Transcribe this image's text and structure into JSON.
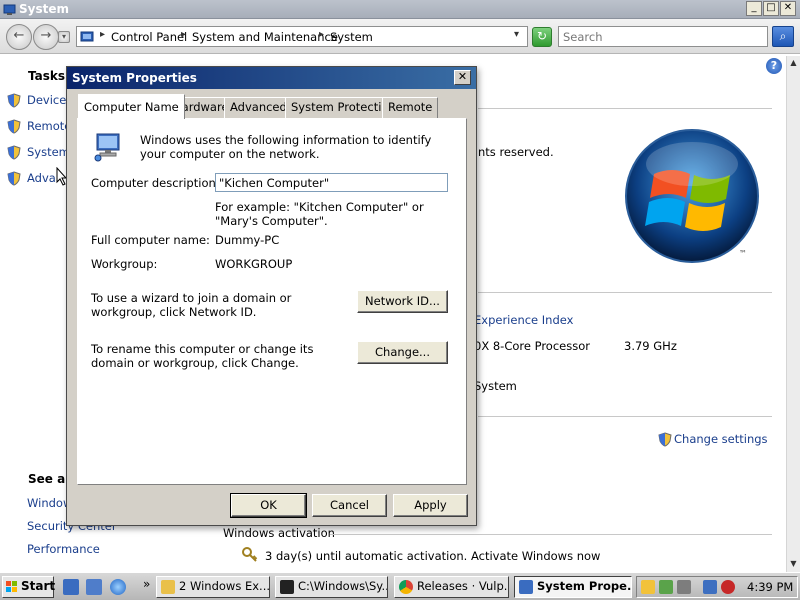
{
  "window": {
    "title": "System",
    "min": "_",
    "max": "□",
    "close": "✕"
  },
  "nav": {
    "back": "←",
    "forward": "→",
    "crumbs": [
      "Control Panel",
      "System and Maintenance",
      "System"
    ],
    "search_placeholder": "Search",
    "search_icon": "search-icon",
    "refresh_icon": "refresh-icon"
  },
  "background": {
    "tasks_heading": "Tasks",
    "tasks": [
      "Device M",
      "Remote",
      "System",
      "Advan"
    ],
    "see_also_heading": "See als",
    "see_also": [
      "Window",
      "Security Center",
      "Performance"
    ],
    "rights_text": "nts reserved.",
    "experience_index": "Experience Index",
    "processor": "0X 8-Core Processor",
    "processor_speed": "3.79 GHz",
    "system_type": "System",
    "change_settings": "Change settings",
    "activation_heading": "Windows activation",
    "activation_text": "3 day(s) until automatic activation. Activate Windows now",
    "help": "?"
  },
  "dialog": {
    "title": "System Properties",
    "close": "✕",
    "tabs": [
      "Computer Name",
      "Hardware",
      "Advanced",
      "System Protection",
      "Remote"
    ],
    "active_tab": "Computer Name",
    "intro": "Windows uses the following information to identify your computer on the network.",
    "description_label": "Computer description:",
    "description_value": "\"Kichen Computer\"",
    "example": "For example: \"Kitchen Computer\" or \"Mary's Computer\".",
    "full_name_label": "Full computer name:",
    "full_name_value": "Dummy-PC",
    "workgroup_label": "Workgroup:",
    "workgroup_value": "WORKGROUP",
    "wizard_text": "To use a wizard to join a domain or workgroup, click Network ID.",
    "network_id_button": "Network ID...",
    "rename_text": "To rename this computer or change its domain or workgroup, click Change.",
    "change_button": "Change...",
    "ok": "OK",
    "cancel": "Cancel",
    "apply": "Apply"
  },
  "taskbar": {
    "start": "Start",
    "overflow": "»",
    "buttons": [
      {
        "label": "2 Windows Ex...",
        "icon": "folder-icon"
      },
      {
        "label": "C:\\Windows\\Sy...",
        "icon": "console-icon"
      },
      {
        "label": "Releases · Vulp...",
        "icon": "chrome-icon"
      },
      {
        "label": "System Prope...",
        "icon": "system-icon"
      }
    ],
    "clock": "4:39 PM"
  },
  "colors": {
    "link": "#1a3e8c",
    "dialog_title": "#0a246a",
    "dialog_face": "#d4d0c8"
  }
}
